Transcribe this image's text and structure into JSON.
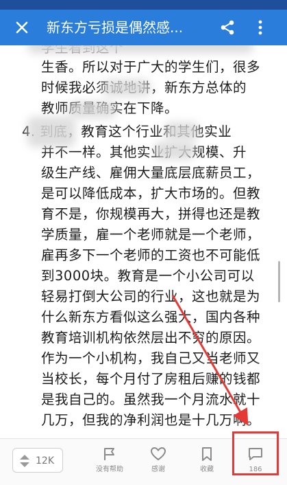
{
  "header": {
    "title": "新东方亏损是偶然感...",
    "close_icon": "close-icon",
    "share_icon": "share-icon",
    "more_icon": "more-vert-icon"
  },
  "article": {
    "lines": [
      "学生看到这个",
      "生香。所以对于广大的学生们，很多",
      "时候我必须诚地讲，新东方总体的",
      "教师质量确实在下降。",
      "4. 到底，教育这个行业和其他实业",
      "并不一样。其他实业扩大规模、升",
      "级生产线、雇佣大量底层底薪员工，",
      "是可以降低成本，扩大市场的。但教",
      "育不是，你规模再大，拼得也还是教",
      "学质量，雇一个老师就是一个老师，",
      "雇再多下一个老师的工资也不可能低",
      "到3000块。教育是一个小公司可以",
      "轻易打倒大公司的行业，这也就是为",
      "什么新东方看似这么强大，国内各种",
      "教育培训机构依然层出不穷的原因。",
      "作为一个小机构，我自己又当老师又",
      "当校长，每个月付了房租后赚的钱都",
      "是我自己的。虽然我一个月流水就十",
      "几万，但我的净利润也是十几万啊。"
    ]
  },
  "bottom_bar": {
    "vote_count": "12K",
    "unhelpful_label": "没有帮助",
    "thanks_label": "感谢",
    "collect_label": "收藏",
    "comment_count": "186"
  },
  "colors": {
    "appbar": "#2a7ddb",
    "statusbar": "#1f4f9a",
    "annotation": "#e53935"
  }
}
